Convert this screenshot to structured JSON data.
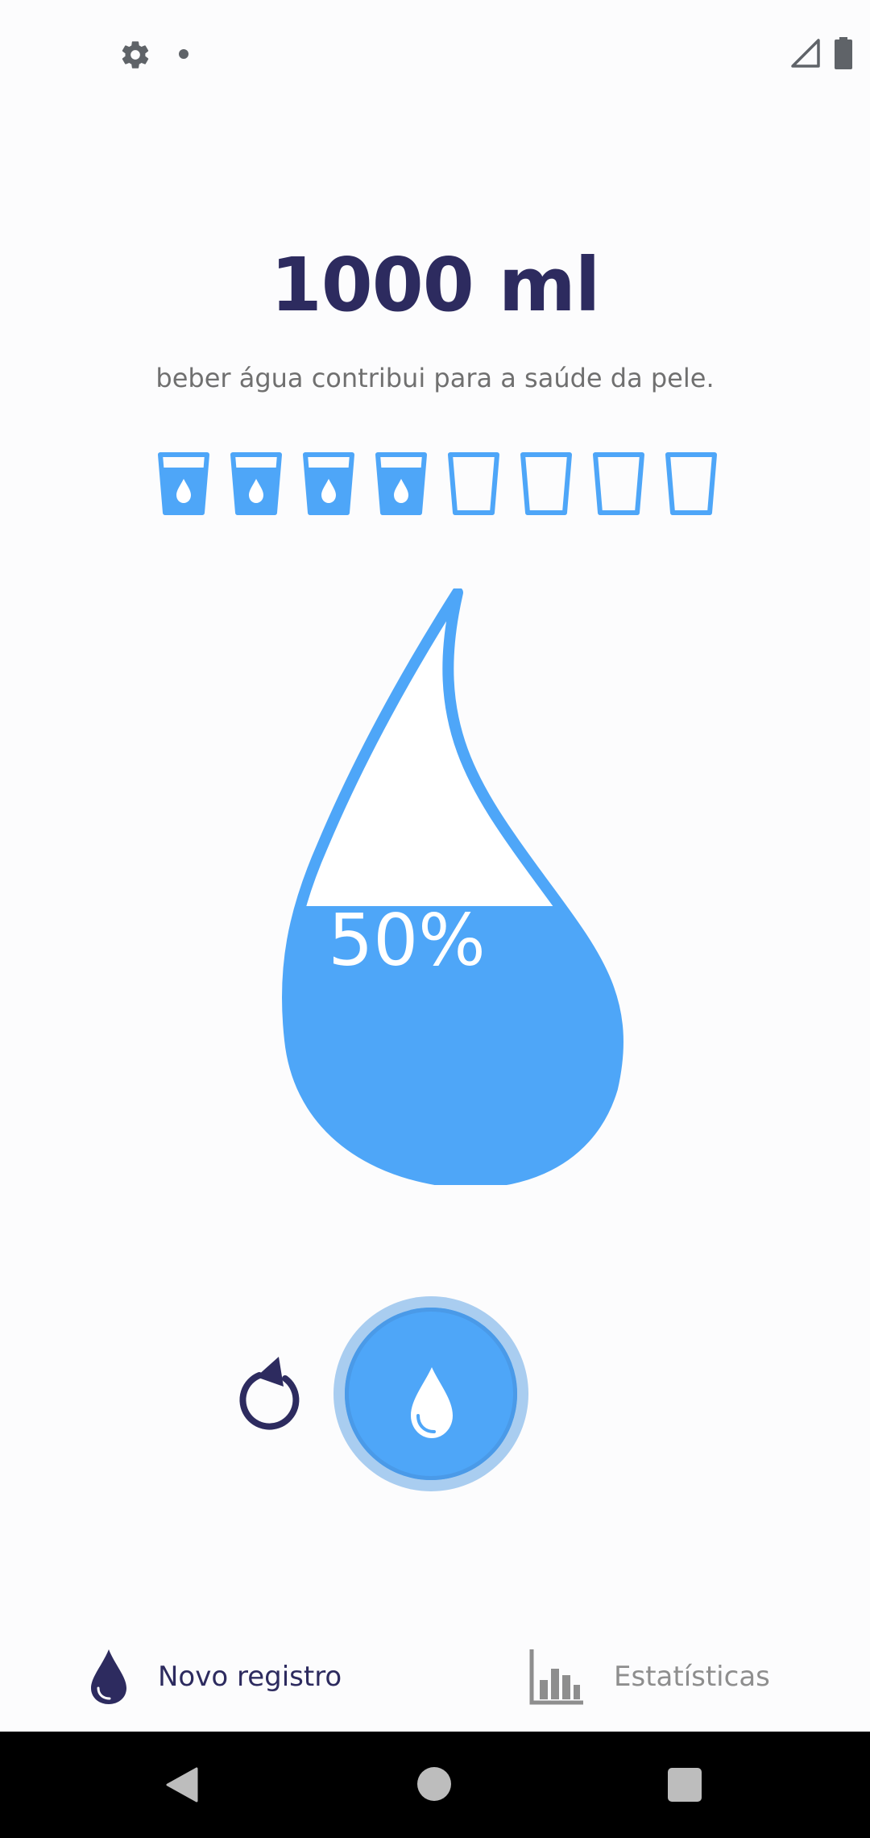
{
  "status_bar": {
    "icons": [
      "gear-icon",
      "notification-dot",
      "signal-icon",
      "battery-icon"
    ]
  },
  "goal": {
    "amount": "1000 ml",
    "tip": "beber água contribui para a saúde da pele."
  },
  "glasses": {
    "total": 8,
    "filled": 4
  },
  "progress": {
    "label": "50%",
    "fraction": 0.5
  },
  "actions": {
    "reset_icon": "reset-icon",
    "add_icon": "water-drop-icon"
  },
  "bottom_nav": {
    "records_label": "Novo registro",
    "stats_label": "Estatísticas"
  },
  "colors": {
    "primary": "#4ea6f8",
    "dark": "#2d2b5f",
    "muted": "#8e8e8e"
  }
}
